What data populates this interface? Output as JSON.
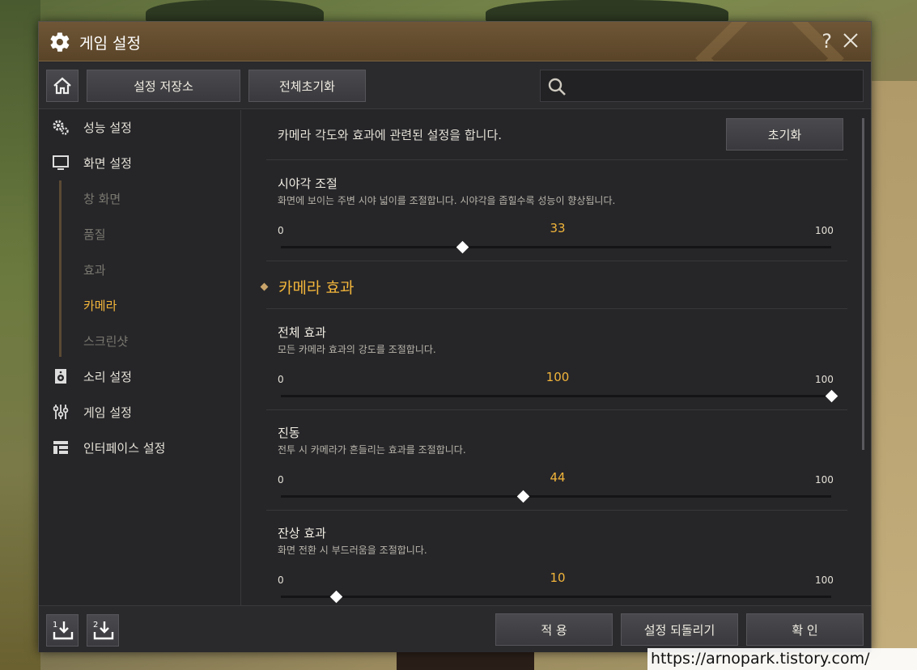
{
  "window": {
    "title": "게임 설정",
    "help": "?"
  },
  "toolbar": {
    "store_label": "설정 저장소",
    "reset_all_label": "전체초기화",
    "search_placeholder": ""
  },
  "sidebar": {
    "items": [
      {
        "label": "성능 설정",
        "icon": "gears-icon"
      },
      {
        "label": "화면 설정",
        "icon": "monitor-icon"
      },
      {
        "label": "창 화면",
        "sub": true
      },
      {
        "label": "품질",
        "sub": true
      },
      {
        "label": "효과",
        "sub": true
      },
      {
        "label": "카메라",
        "sub": true,
        "active": true
      },
      {
        "label": "스크린샷",
        "sub": true
      },
      {
        "label": "소리 설정",
        "icon": "speaker-icon"
      },
      {
        "label": "게임 설정",
        "icon": "sliders-icon"
      },
      {
        "label": "인터페이스 설정",
        "icon": "layout-icon"
      }
    ]
  },
  "content": {
    "description": "카메라 각도와 효과에 관련된 설정을 합니다.",
    "init_label": "초기화",
    "fov": {
      "title": "시야각 조절",
      "desc": "화면에 보이는 주변 시야 넓이를 조절합니다. 시야각을 좁힐수록 성능이 향상됩니다.",
      "min": "0",
      "max": "100",
      "value": "33",
      "percent": 33
    },
    "camera_effects_title": "카메라 효과",
    "all_effects": {
      "title": "전체 효과",
      "desc": "모든 카메라 효과의 강도를 조절합니다.",
      "min": "0",
      "max": "100",
      "value": "100",
      "percent": 100
    },
    "vibration": {
      "title": "진동",
      "desc": "전투 시 카메라가 흔들리는 효과를 조절합니다.",
      "min": "0",
      "max": "100",
      "value": "44",
      "percent": 44
    },
    "afterimage": {
      "title": "잔상 효과",
      "desc": "화면 전환 시 부드러움을 조절합니다.",
      "min": "0",
      "max": "100",
      "value": "10",
      "percent": 10
    }
  },
  "footer": {
    "slot1": "1",
    "slot2": "2",
    "apply_label": "적 용",
    "revert_label": "설정 되돌리기",
    "confirm_label": "확 인"
  },
  "watermark": "https://arnopark.tistory.com/",
  "colors": {
    "accent": "#f2b53a",
    "panel": "#262629",
    "titlebar": "#5a4428"
  }
}
